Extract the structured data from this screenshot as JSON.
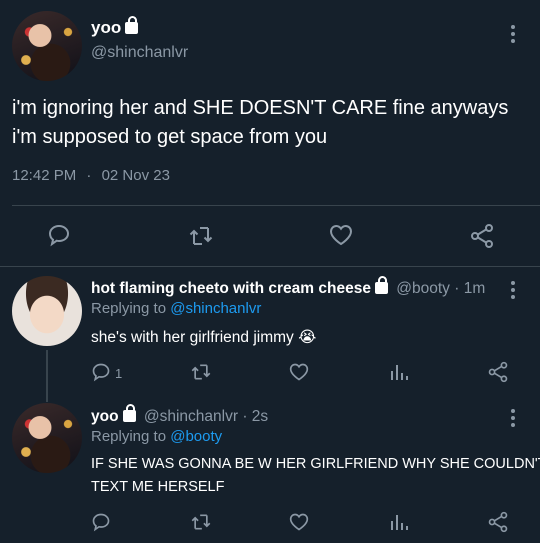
{
  "main_tweet": {
    "name": "yoo",
    "handle": "@shinchanlvr",
    "text": "i'm ignoring her and SHE DOESN'T CARE fine anyways i'm supposed to get space from you",
    "time": "12:42 PM",
    "dot": "·",
    "date": "02 Nov 23",
    "actions": [
      "reply-icon",
      "retweet-icon",
      "like-icon",
      "share-icon"
    ]
  },
  "reply1": {
    "name": "hot flaming cheeto with cream cheese",
    "handle": "@booty",
    "age": "· 1m",
    "replying_prefix": "Replying to",
    "replying_handle": "@shinchanlvr",
    "text": "she's with her girlfriend jimmy 😭",
    "reply_count": "1"
  },
  "reply2": {
    "name": "yoo",
    "handle": "@shinchanlvr",
    "age": "· 2s",
    "replying_prefix": "Replying to",
    "replying_handle": "@booty",
    "text_line1": "IF SHE WAS GONNA BE W HER GIRLFRIEND WHY SHE COULDN'T",
    "text_line2": "TEXT ME HERSELF"
  },
  "colors": {
    "background": "#15202b",
    "muted": "#8b98a5",
    "link": "#1d9bf0",
    "divider": "#38444d"
  }
}
